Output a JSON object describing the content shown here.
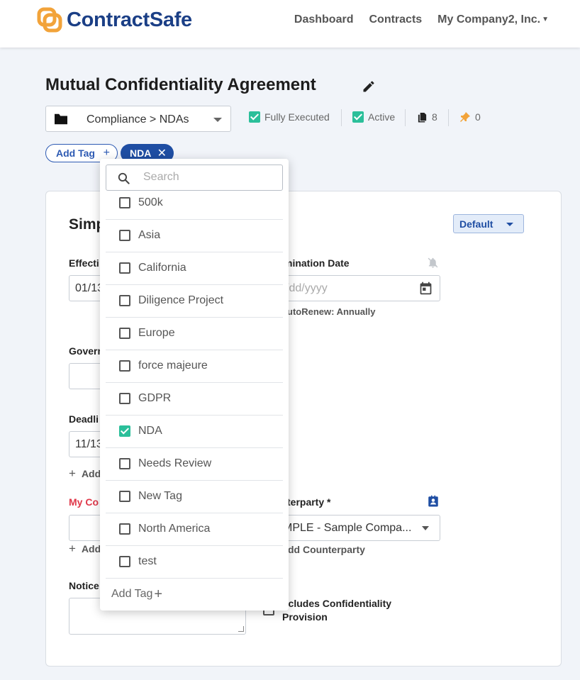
{
  "header": {
    "brand": "ContractSafe",
    "nav": {
      "dashboard": "Dashboard",
      "contracts": "Contracts",
      "company": "My Company2, Inc."
    }
  },
  "contract": {
    "title": "Mutual Confidentiality Agreement",
    "folder": "Compliance > NDAs",
    "status": {
      "fully_executed": "Fully Executed",
      "active": "Active",
      "documents_count": "8",
      "pins_count": "0"
    },
    "tags": {
      "add_tag": "Add Tag",
      "selected": "NDA"
    }
  },
  "card": {
    "section_title": "Simp",
    "default_btn": "Default",
    "effective_label": "Effecti",
    "effective_value": "01/13",
    "termination_label": "mination Date",
    "termination_placeholder": "/dd/yyyy",
    "autorenew": "utoRenew: Annually",
    "governing_label": "Govern",
    "deadline_label": "Deadli",
    "deadline_value": "11/13",
    "add_link_1": "Add",
    "my_company_label": "My Co",
    "counterparty_label": "terparty",
    "counterparty_required": "*",
    "counterparty_value": "MPLE - Sample Compa...",
    "add_counterparty": "dd Counterparty",
    "add_link_2": "Add",
    "notice_label": "Notice",
    "confidentiality_line1": "ncludes Confidentiality",
    "confidentiality_line2": "Provision"
  },
  "dropdown": {
    "search_placeholder": "Search",
    "options": [
      {
        "label": "500k",
        "checked": false
      },
      {
        "label": "Asia",
        "checked": false
      },
      {
        "label": "California",
        "checked": false
      },
      {
        "label": "Diligence Project",
        "checked": false
      },
      {
        "label": "Europe",
        "checked": false
      },
      {
        "label": "force majeure",
        "checked": false
      },
      {
        "label": "GDPR",
        "checked": false
      },
      {
        "label": "NDA",
        "checked": true
      },
      {
        "label": "Needs Review",
        "checked": false
      },
      {
        "label": "New Tag",
        "checked": false
      },
      {
        "label": "North America",
        "checked": false
      },
      {
        "label": "test",
        "checked": false
      }
    ],
    "add_tag": "Add Tag"
  },
  "colors": {
    "brand": "#1b3f86",
    "logo": "#f2a33a",
    "check": "#2bbf9a",
    "tag": "#1f4ea3"
  },
  "icons": [
    "logo-icon",
    "edit-icon",
    "folder-icon",
    "document-icon",
    "pin-icon",
    "bell-off-icon",
    "calendar-icon",
    "contact-card-icon",
    "search-icon"
  ]
}
